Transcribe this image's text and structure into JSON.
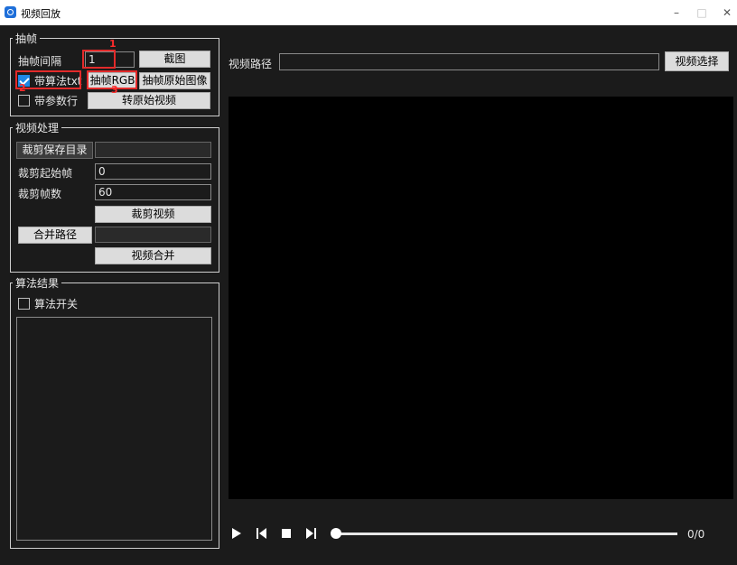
{
  "window": {
    "title": "视频回放",
    "minimize": "–",
    "maximize": "□",
    "close": "✕"
  },
  "extract": {
    "group_title": "抽帧",
    "interval_label": "抽帧间隔",
    "interval_value": "1",
    "screenshot_btn": "截图",
    "algo_checkbox_label": "带算法txt",
    "algo_checked": true,
    "extract_rgb_btn": "抽帧RGB",
    "extract_raw_btn": "抽帧原始图像",
    "params_checkbox_label": "带参数行",
    "params_checked": false,
    "to_raw_video_btn": "转原始视频"
  },
  "annotations": {
    "n1": "1",
    "n2": "2",
    "n3": "3"
  },
  "processing": {
    "group_title": "视频处理",
    "crop_save_dir_btn": "裁剪保存目录",
    "crop_save_dir_value": "",
    "crop_start_label": "裁剪起始帧",
    "crop_start_value": "0",
    "crop_frames_label": "裁剪帧数",
    "crop_frames_value": "60",
    "crop_video_btn": "裁剪视频",
    "merge_path_btn": "合并路径",
    "merge_path_value": "",
    "merge_video_btn": "视频合并"
  },
  "results": {
    "group_title": "算法结果",
    "algo_switch_label": "算法开关",
    "algo_switch_checked": false
  },
  "video": {
    "path_label": "视频路径",
    "path_value": "",
    "select_btn": "视频选择",
    "time_display": "0/0",
    "progress": 0
  },
  "icons": {
    "play": "play-icon",
    "prev": "prev-frame-icon",
    "stop": "stop-icon",
    "next": "next-frame-icon"
  }
}
